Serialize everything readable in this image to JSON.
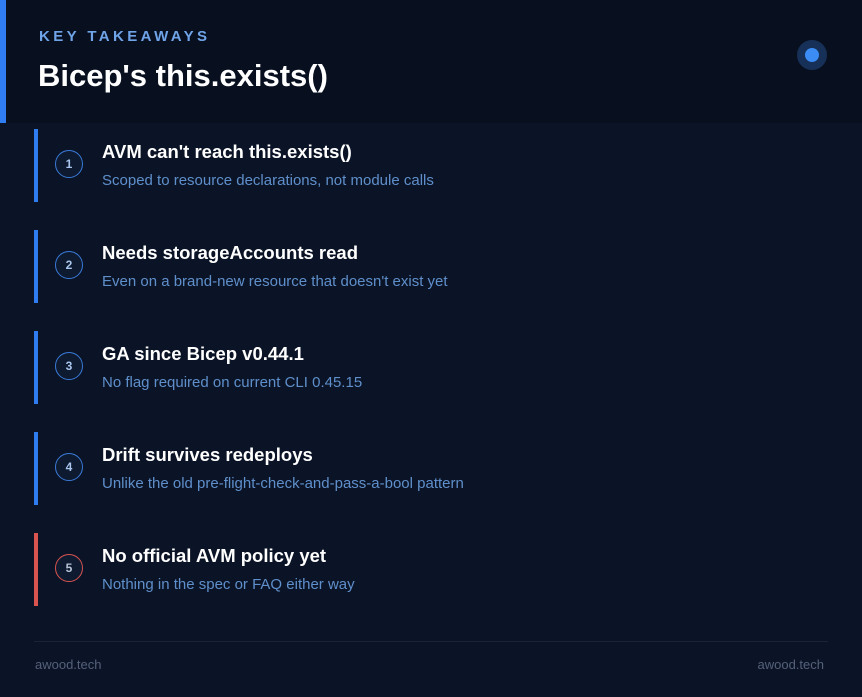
{
  "header": {
    "eyebrow": "KEY TAKEAWAYS",
    "title": "Bicep's this.exists()"
  },
  "items": [
    {
      "number": "1",
      "title": "AVM can't reach this.exists()",
      "description": "Scoped to resource declarations, not module calls",
      "accent": "#2f7df0"
    },
    {
      "number": "2",
      "title": "Needs storageAccounts read",
      "description": "Even on a brand-new resource that doesn't exist yet",
      "accent": "#2f7df0"
    },
    {
      "number": "3",
      "title": "GA since Bicep v0.44.1",
      "description": "No flag required on current CLI 0.45.15",
      "accent": "#2f7df0"
    },
    {
      "number": "4",
      "title": "Drift survives redeploys",
      "description": "Unlike the old pre-flight-check-and-pass-a-bool pattern",
      "accent": "#2f7df0"
    },
    {
      "number": "5",
      "title": "No official AVM policy yet",
      "description": "Nothing in the spec or FAQ either way",
      "accent": "#d9534f"
    }
  ],
  "footer": {
    "left": "awood.tech",
    "right": "awood.tech"
  },
  "colors": {
    "background": "#0b1426",
    "header_background": "#081020",
    "accent_blue": "#2f7df0",
    "accent_red": "#d9534f",
    "description_text": "#5f8fcb"
  }
}
